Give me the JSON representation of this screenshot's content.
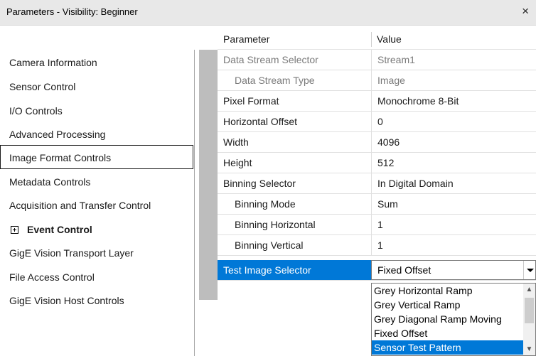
{
  "window": {
    "title": "Parameters - Visibility: Beginner",
    "close_glyph": "×"
  },
  "header": {
    "parameter": "Parameter",
    "value": "Value"
  },
  "sidebar": {
    "items": [
      {
        "label": "Camera Information"
      },
      {
        "label": "Sensor Control"
      },
      {
        "label": "I/O Controls"
      },
      {
        "label": "Advanced Processing"
      },
      {
        "label": "Image Format Controls"
      },
      {
        "label": "Metadata Controls"
      },
      {
        "label": "Acquisition and Transfer Control"
      },
      {
        "label": "Event Control"
      },
      {
        "label": "GigE Vision Transport Layer"
      },
      {
        "label": "File Access Control"
      },
      {
        "label": "GigE Vision Host Controls"
      }
    ],
    "selected_index": 4
  },
  "grid": {
    "rows": [
      {
        "param": "Data Stream Selector",
        "value": "Stream1"
      },
      {
        "param": "Data Stream Type",
        "value": "Image"
      },
      {
        "param": "Pixel Format",
        "value": "Monochrome 8-Bit"
      },
      {
        "param": "Horizontal Offset",
        "value": "0"
      },
      {
        "param": "Width",
        "value": "4096"
      },
      {
        "param": "Height",
        "value": "512"
      },
      {
        "param": "Binning Selector",
        "value": "In Digital Domain"
      },
      {
        "param": "Binning Mode",
        "value": "Sum"
      },
      {
        "param": "Binning Horizontal",
        "value": "1"
      },
      {
        "param": "Binning Vertical",
        "value": "1"
      },
      {
        "param": "Test Image Selector",
        "value": "Fixed Offset"
      }
    ]
  },
  "dropdown": {
    "options": [
      "Grey Horizontal Ramp",
      "Grey Vertical Ramp",
      "Grey Diagonal Ramp Moving",
      "Fixed Offset",
      "Sensor Test Pattern"
    ],
    "highlighted": "Sensor Test Pattern"
  },
  "colors": {
    "selection": "#0078d7",
    "gutter": "#bdbdbd",
    "titlebar": "#e8e8e8"
  }
}
